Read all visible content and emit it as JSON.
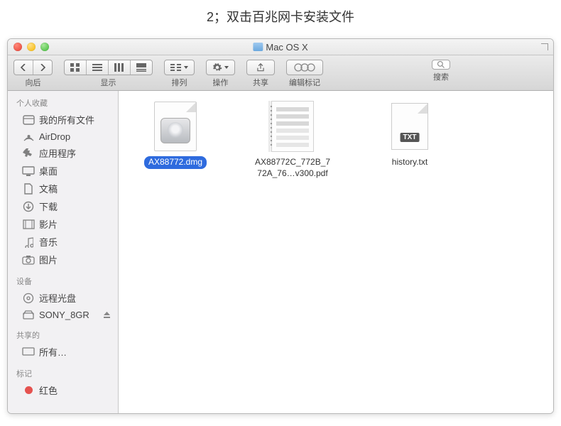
{
  "page_heading": "2；双击百兆网卡安装文件",
  "window": {
    "title": "Mac OS X"
  },
  "toolbar": {
    "back_label": "向后",
    "view_label": "显示",
    "arrange_label": "排列",
    "action_label": "操作",
    "share_label": "共享",
    "tags_label": "编辑标记",
    "search_label": "搜索"
  },
  "sidebar": {
    "sections": [
      {
        "header": "个人收藏",
        "items": [
          {
            "icon": "all-my-files",
            "label": "我的所有文件"
          },
          {
            "icon": "airdrop",
            "label": "AirDrop"
          },
          {
            "icon": "applications",
            "label": "应用程序"
          },
          {
            "icon": "desktop",
            "label": "桌面"
          },
          {
            "icon": "documents",
            "label": "文稿"
          },
          {
            "icon": "downloads",
            "label": "下载"
          },
          {
            "icon": "movies",
            "label": "影片"
          },
          {
            "icon": "music",
            "label": "音乐"
          },
          {
            "icon": "pictures",
            "label": "图片"
          }
        ]
      },
      {
        "header": "设备",
        "items": [
          {
            "icon": "remote-disc",
            "label": "远程光盘"
          },
          {
            "icon": "drive",
            "label": "SONY_8GR",
            "eject": true
          }
        ]
      },
      {
        "header": "共享的",
        "items": [
          {
            "icon": "shared",
            "label": "所有…"
          }
        ]
      },
      {
        "header": "标记",
        "items": [
          {
            "icon": "tag-red",
            "label": "红色"
          }
        ]
      }
    ]
  },
  "files": [
    {
      "name": "AX88772.dmg",
      "type": "dmg",
      "selected": true
    },
    {
      "name": "AX88772C_772B_772A_76…v300.pdf",
      "type": "pdf",
      "selected": false
    },
    {
      "name": "history.txt",
      "type": "txt",
      "selected": false
    }
  ],
  "txt_badge": "TXT"
}
